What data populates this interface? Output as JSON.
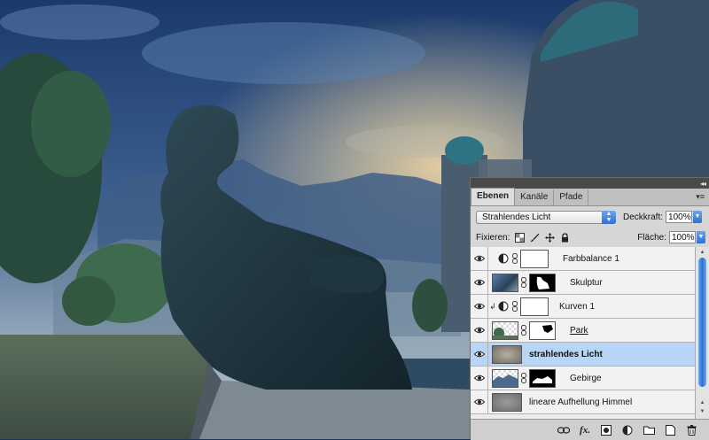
{
  "layers_panel": {
    "tabs": [
      {
        "label": "Ebenen",
        "active": true
      },
      {
        "label": "Kanäle",
        "active": false
      },
      {
        "label": "Pfade",
        "active": false
      }
    ],
    "blend_mode": "Strahlendes Licht",
    "opacity_label": "Deckkraft:",
    "opacity_value": "100%",
    "lock_label": "Fixieren:",
    "fill_label": "Fläche:",
    "fill_value": "100%",
    "layers": [
      {
        "name": "Farbbalance 1",
        "type": "adjustment",
        "adjustment_icon": "half-circle-icon",
        "mask": "white",
        "selected": false,
        "clipped": false
      },
      {
        "name": "Skulptur",
        "type": "image",
        "mask": "black-white",
        "selected": false,
        "clipped": false
      },
      {
        "name": "Kurven 1",
        "type": "adjustment",
        "adjustment_icon": "half-circle-icon",
        "mask": "white",
        "selected": false,
        "clipped": true
      },
      {
        "name": "Park",
        "type": "image",
        "mask": "white-black",
        "selected": false,
        "clipped": false
      },
      {
        "name": "strahlendes Licht",
        "type": "image",
        "mask": "none",
        "selected": true,
        "clipped": false
      },
      {
        "name": "Gebirge",
        "type": "image",
        "mask": "black-white",
        "selected": false,
        "clipped": false
      },
      {
        "name": "lineare Aufhellung Himmel",
        "type": "image",
        "mask": "none",
        "selected": false,
        "clipped": false
      }
    ],
    "bottom_icons": [
      "link-layers-icon",
      "fx-icon",
      "add-mask-icon",
      "adjustment-layer-icon",
      "new-group-icon",
      "new-layer-icon",
      "trash-icon"
    ],
    "bottom_icon_fx_text": "fx."
  },
  "colors": {
    "selected_row": "#b7d5f6",
    "accent_blue": "#2f6fd0",
    "panel_bg": "#d6d6d6"
  }
}
